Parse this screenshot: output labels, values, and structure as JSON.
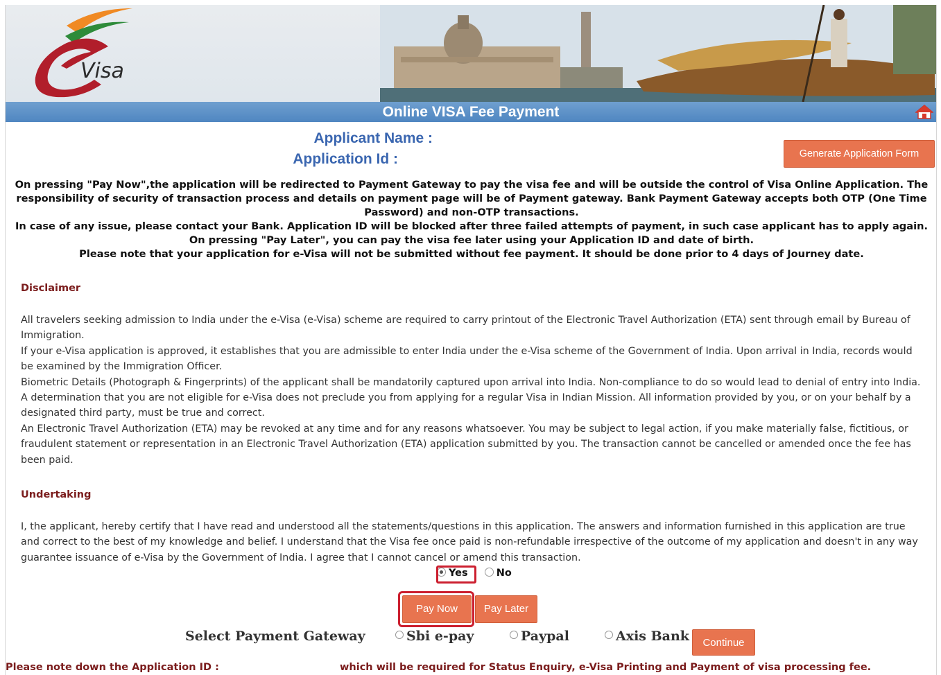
{
  "header": {
    "logo_text": "Visa",
    "title": "Online VISA Fee Payment"
  },
  "applicant": {
    "name_label": "Applicant Name :",
    "id_label": "Application Id :",
    "generate_label": "Generate Application Form"
  },
  "notice": {
    "lines": [
      "On pressing \"Pay Now\",the application will be redirected to Payment Gateway to pay the visa fee and will be outside the control of Visa Online Application. The responsibility of security of transaction process and details on payment page will be of Payment gateway. Bank Payment Gateway accepts both OTP (One Time Password) and non-OTP transactions.",
      "In case of any issue, please contact your Bank. Application ID will be blocked after three failed attempts of payment, in such case applicant has to apply again. On pressing \"Pay Later\", you can pay the visa fee later using your Application ID and date of birth.",
      "Please note that your application for e-Visa will not be submitted without fee payment. It should be done prior to 4 days of Journey date."
    ]
  },
  "disclaimer": {
    "heading": "Disclaimer",
    "paragraphs": [
      "All travelers seeking admission to India under the e-Visa (e-Visa) scheme are required to carry printout of the Electronic Travel Authorization (ETA) sent through email by Bureau of Immigration.",
      "If your e-Visa application is approved, it establishes that you are admissible to enter India under the e-Visa scheme of the Government of India. Upon arrival in India, records would be examined by the Immigration Officer.",
      "Biometric Details (Photograph & Fingerprints) of the applicant shall be mandatorily captured upon arrival into India. Non-compliance to do so would lead to denial of entry into India. A determination that you are not eligible for e-Visa does not preclude you from applying for a regular Visa in Indian Mission. All information provided by you, or on your behalf by a designated third party, must be true and correct.",
      "An Electronic Travel Authorization (ETA) may be revoked at any time and for any reasons whatsoever. You may be subject to legal action, if you make materially false, fictitious, or fraudulent statement or representation in an Electronic Travel Authorization (ETA) application submitted by you. The transaction cannot be cancelled or amended once the fee has been paid."
    ]
  },
  "undertaking": {
    "heading": "Undertaking",
    "text": "I, the applicant, hereby certify that I have read and understood all the statements/questions in this application. The answers and information furnished in this application are true and correct to the best of my knowledge and belief. I understand that the Visa fee once paid is non-refundable irrespective of the outcome of my application and doesn't in any way guarantee issuance of e-Visa by the Government of India. I agree that I cannot cancel or amend this transaction.",
    "yes_label": "Yes",
    "no_label": "No"
  },
  "buttons": {
    "pay_now": "Pay Now",
    "pay_later": "Pay Later",
    "continue": "Continue"
  },
  "gateway": {
    "label": "Select Payment Gateway",
    "options": [
      "Sbi e-pay",
      "Paypal",
      "Axis Bank"
    ]
  },
  "footer": {
    "left": "Please note down the Application ID :",
    "right": "which will be required for Status Enquiry, e-Visa Printing and Payment of visa processing fee."
  },
  "colors": {
    "accent": "#e8744f",
    "title_bar": "#4f86c1",
    "heading": "#7b1d1d",
    "applicant": "#3a66b0",
    "highlight": "#cc1f2f"
  }
}
